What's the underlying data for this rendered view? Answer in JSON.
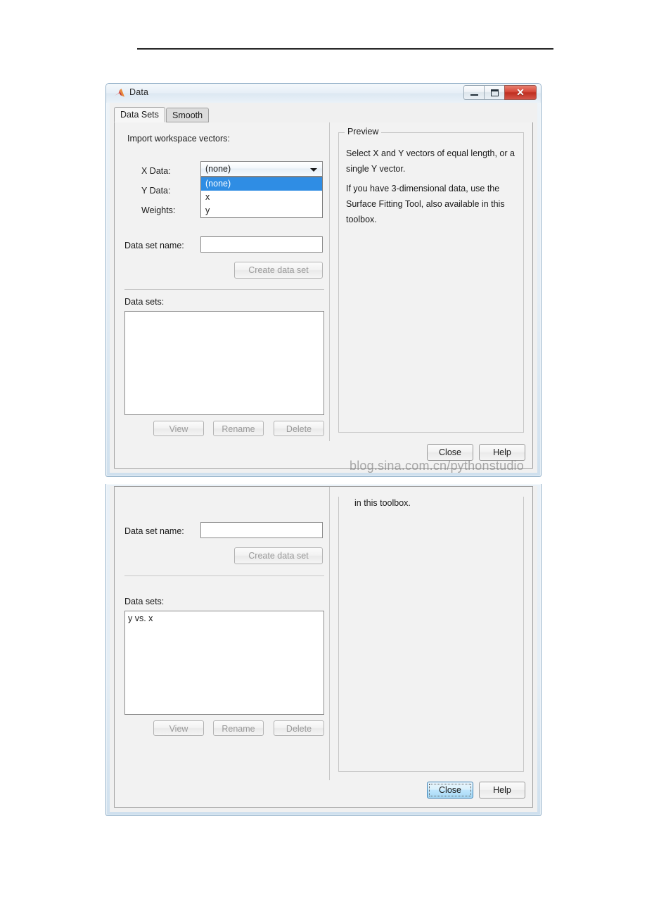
{
  "window": {
    "title": "Data",
    "icon": "matlab-membrane-icon",
    "buttons": {
      "minimize": "minimize-icon",
      "maximize": "maximize-icon",
      "close": "✕"
    }
  },
  "tabs": [
    {
      "label": "Data Sets",
      "active": true
    },
    {
      "label": "Smooth",
      "active": false
    }
  ],
  "left_pane": {
    "import_label": "Import workspace vectors:",
    "fields": [
      {
        "label": "X Data:",
        "value": "(none)"
      },
      {
        "label": "Y Data:",
        "value": ""
      },
      {
        "label": "Weights:",
        "value": ""
      }
    ],
    "dropdown_open": true,
    "dropdown_options": [
      {
        "label": "(none)",
        "selected": true
      },
      {
        "label": "x",
        "selected": false
      },
      {
        "label": "y",
        "selected": false
      }
    ],
    "dataset_name_label": "Data set name:",
    "dataset_name_value": "",
    "create_button": "Create data set",
    "datasets_label": "Data sets:",
    "datasets_items": [],
    "list_actions": [
      {
        "label": "View"
      },
      {
        "label": "Rename"
      },
      {
        "label": "Delete"
      }
    ]
  },
  "preview": {
    "group_title": "Preview",
    "paragraph_1": "Select X and Y vectors of equal length, or a single Y vector.",
    "paragraph_2": "If you have 3-dimensional data, use the Surface Fitting Tool, also available in this toolbox."
  },
  "footer": {
    "close": "Close",
    "help": "Help"
  },
  "watermark": "blog.sina.com.cn/pythonstudio",
  "window2": {
    "preview_tail_text": "in this toolbox.",
    "dataset_name_label": "Data set name:",
    "dataset_name_value": "",
    "create_button": "Create data set",
    "datasets_label": "Data sets:",
    "datasets_items": [
      "y vs. x"
    ],
    "list_actions": [
      {
        "label": "View"
      },
      {
        "label": "Rename"
      },
      {
        "label": "Delete"
      }
    ],
    "footer": {
      "close": "Close",
      "help": "Help"
    }
  },
  "colors": {
    "accent_selection": "#2f8de4",
    "close_button_red": "#bf2f20",
    "window_border": "#8fadc6",
    "panel_bg": "#f2f2f2"
  }
}
